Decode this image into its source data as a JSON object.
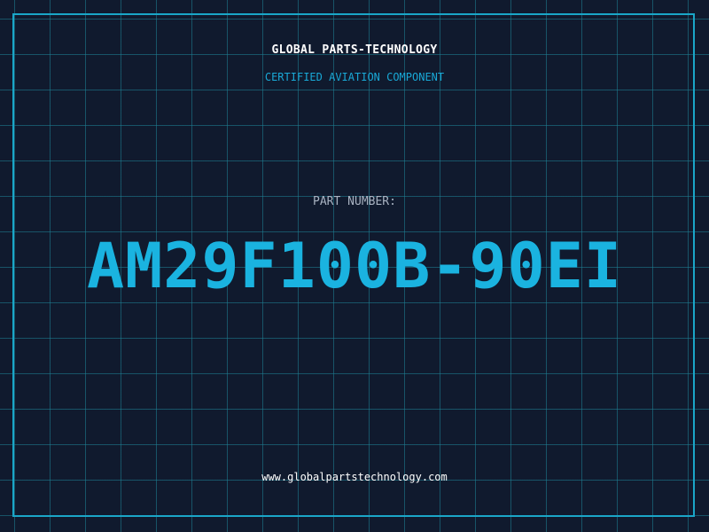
{
  "header": {
    "company_name": "GLOBAL PARTS-TECHNOLOGY",
    "tagline": "CERTIFIED AVIATION COMPONENT"
  },
  "part": {
    "label": "PART NUMBER:",
    "number": "AM29F100B-90EI"
  },
  "footer": {
    "website": "www.globalpartstechnology.com"
  },
  "colors": {
    "background": "#101a2e",
    "grid": "#1e8296",
    "accent": "#1ab3e0",
    "frame": "#1aa6c8",
    "label": "#a9b3c2",
    "text": "#ffffff"
  }
}
